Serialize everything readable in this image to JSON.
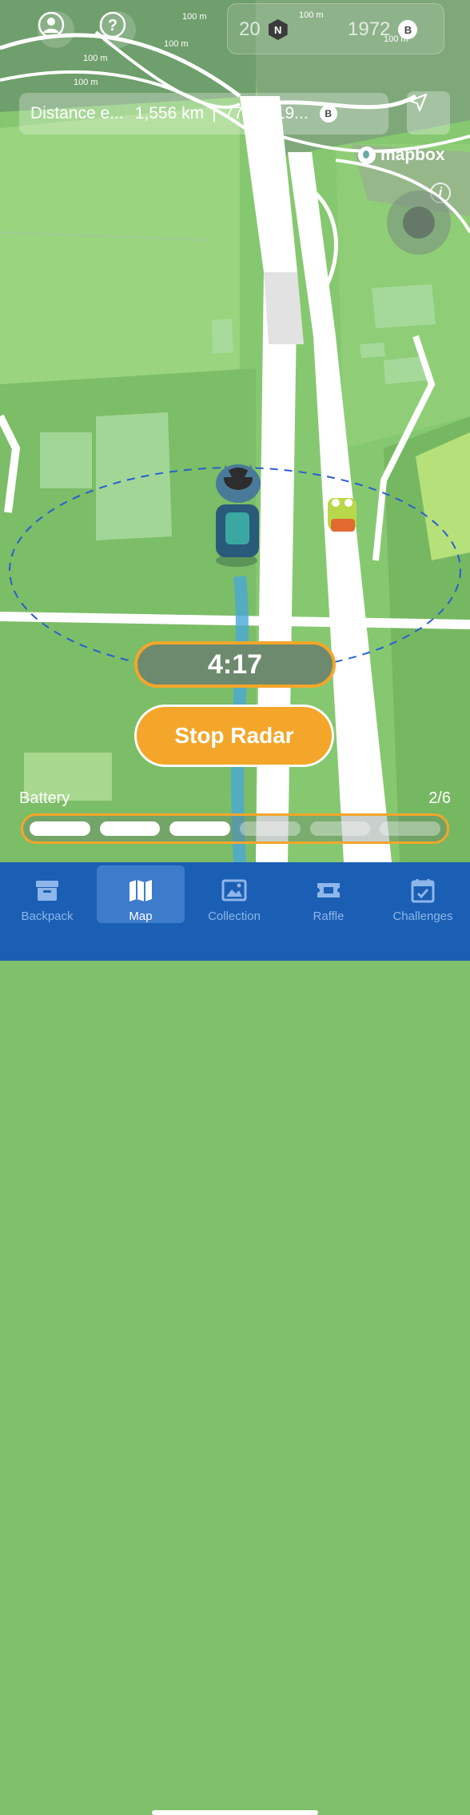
{
  "header": {
    "stats": [
      {
        "value": "20",
        "badge": "N"
      },
      {
        "value": "1972",
        "badge": "B"
      }
    ]
  },
  "map": {
    "scale_labels": [
      "100 m",
      "100 m",
      "100 m",
      "100 m",
      "100 m",
      "100 m"
    ],
    "attribution": "mapbox"
  },
  "distance_bar": {
    "label": "Distance e...",
    "distance": "1,556 km",
    "separator": "|",
    "value": "77,77819...",
    "badge": "B"
  },
  "radar": {
    "timer": "4:17",
    "stop_label": "Stop Radar"
  },
  "battery": {
    "label": "Battery",
    "count": "2/6",
    "filled": 3,
    "total": 6
  },
  "nav": {
    "items": [
      {
        "label": "Backpack",
        "icon": "box-icon",
        "active": false
      },
      {
        "label": "Map",
        "icon": "map-icon",
        "active": true
      },
      {
        "label": "Collection",
        "icon": "image-icon",
        "active": false
      },
      {
        "label": "Raffle",
        "icon": "ticket-icon",
        "active": false
      },
      {
        "label": "Challenges",
        "icon": "calendar-check-icon",
        "active": false
      }
    ]
  },
  "colors": {
    "accent": "#f4a62a",
    "nav_bg": "#1a5fb4",
    "nav_active": "#3d7ccb",
    "map_green": "#7fc06a",
    "radar_ring": "#2a5fd0"
  }
}
